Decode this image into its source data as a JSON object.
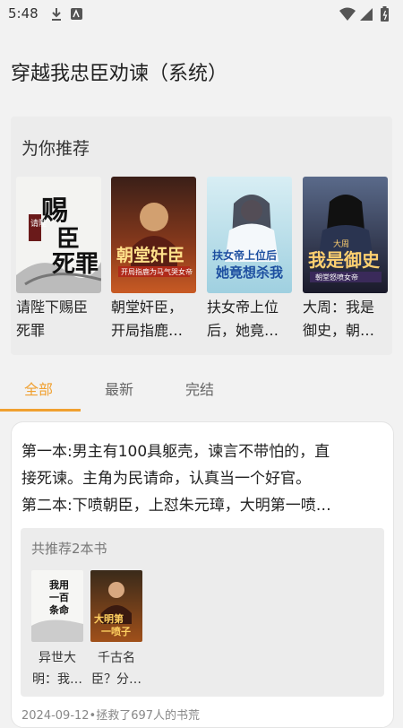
{
  "status": {
    "time": "5:48",
    "icons": [
      "download-icon",
      "app-notification-icon",
      "wifi-icon",
      "signal-icon",
      "battery-icon"
    ]
  },
  "page": {
    "title": "穿越我忠臣劝谏（系统）"
  },
  "recommend": {
    "heading": "为你推荐",
    "books": [
      {
        "title": "请陛下赐臣死罪",
        "cover_text": "请陛下赐臣死罪"
      },
      {
        "title": "朝堂奸臣，开局指鹿…",
        "cover_text": "朝堂奸臣",
        "cover_sub": "开局指鹿为马气哭女帝"
      },
      {
        "title": "扶女帝上位后，她竟…",
        "cover_text": "扶女帝上位后她竟想杀我"
      },
      {
        "title": "大周：我是御史，朝…",
        "cover_text": "我是御史",
        "cover_sub": "朝堂怒喷女帝",
        "cover_top": "大周"
      }
    ]
  },
  "tabs": {
    "items": [
      "全部",
      "最新",
      "完结"
    ],
    "active": "全部"
  },
  "list": {
    "description_lines": [
      "第一本:男主有100具躯壳，谏言不带怕的，直",
      "接死谏。主角为民请命，认真当一个好官。",
      "第二本:下喷朝臣，上怼朱元璋，大明第一喷…"
    ],
    "sub_heading": "共推荐2本书",
    "books": [
      {
        "title_line1": "异世大",
        "title_line2": "明：我…",
        "cover_text": "我用一百条命来谏"
      },
      {
        "title_line1": "千古名",
        "title_line2": "臣？分…",
        "cover_text": "分明是大明第一喷子"
      }
    ],
    "meta": "2024-09-12•拯救了697人的书荒"
  },
  "colors": {
    "accent": "#f0a030",
    "background": "#f2f2f2",
    "card": "#ececec"
  }
}
